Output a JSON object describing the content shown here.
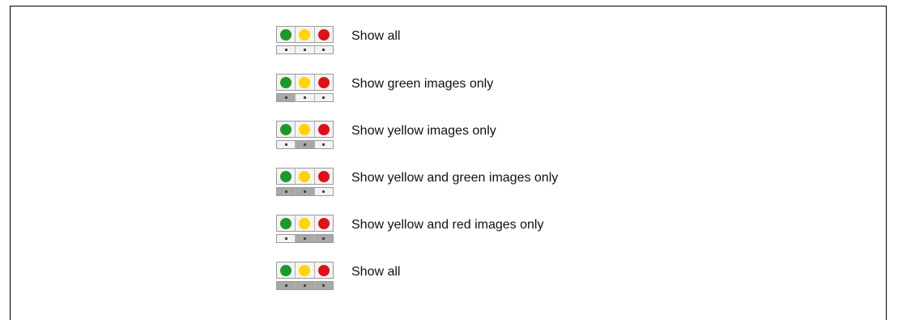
{
  "colors": {
    "green": "#1a9a2a",
    "yellow": "#ffd400",
    "red": "#e0101a",
    "toggle_on": "#a8a8a8",
    "toggle_off": "#f3f3f3"
  },
  "rows": [
    {
      "label": "Show all",
      "toggles": [
        false,
        false,
        false
      ]
    },
    {
      "label": "Show green images only",
      "toggles": [
        true,
        false,
        false
      ]
    },
    {
      "label": "Show yellow images only",
      "toggles": [
        false,
        true,
        false
      ]
    },
    {
      "label": "Show yellow and green images only",
      "toggles": [
        true,
        true,
        false
      ]
    },
    {
      "label": "Show yellow and red images only",
      "toggles": [
        false,
        true,
        true
      ]
    },
    {
      "label": "Show all",
      "toggles": [
        true,
        true,
        true
      ]
    }
  ]
}
